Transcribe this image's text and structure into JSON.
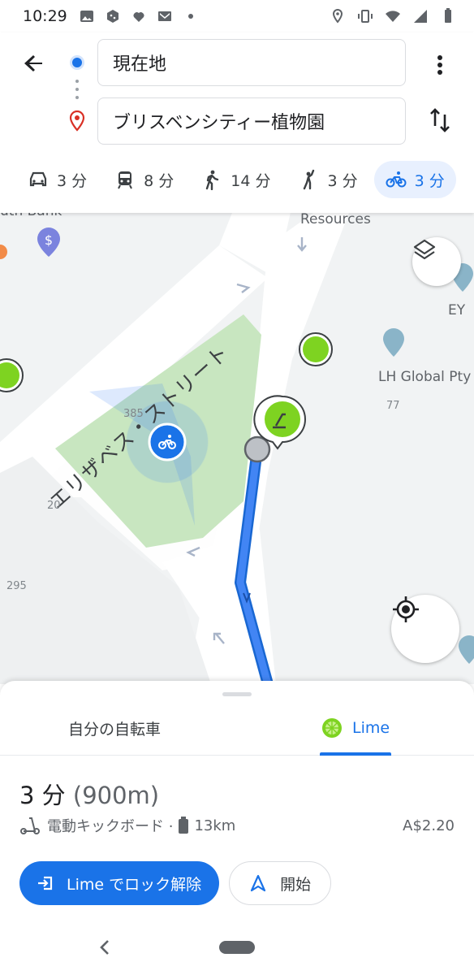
{
  "status_bar": {
    "time": "10:29"
  },
  "search": {
    "origin_value": "現在地",
    "destination_value": "ブリスベンシティー植物園"
  },
  "modes": [
    {
      "name": "car",
      "icon": "car-icon",
      "label": "3 分"
    },
    {
      "name": "transit",
      "icon": "train-icon",
      "label": "8 分"
    },
    {
      "name": "walk",
      "icon": "walk-icon",
      "label": "14 分"
    },
    {
      "name": "ride-share",
      "icon": "hail-icon",
      "label": "3 分"
    },
    {
      "name": "bike",
      "icon": "bike-icon",
      "label": "3 分",
      "active": true
    }
  ],
  "map": {
    "labels": {
      "bank": "uth Bank",
      "resources": "Resources",
      "street": "エリザベス・ストリート",
      "ey": "EY",
      "lh_global": "LH Global Pty",
      "n385": "385",
      "n77": "77",
      "n20": "20",
      "n295": "295"
    }
  },
  "sheet": {
    "tabs": {
      "own_bike": "自分の自転車",
      "lime": "Lime"
    },
    "duration": "3 分",
    "distance": "(900m)",
    "vehicle": "電動キックボード ·",
    "range": "13km",
    "price": "A$2.20",
    "unlock_button": "Lime でロック解除",
    "start_button": "開始"
  },
  "colors": {
    "accent": "#1a73e8",
    "lime_green": "#7ed321",
    "park": "#c8e6c0",
    "route": "#4285f4"
  }
}
